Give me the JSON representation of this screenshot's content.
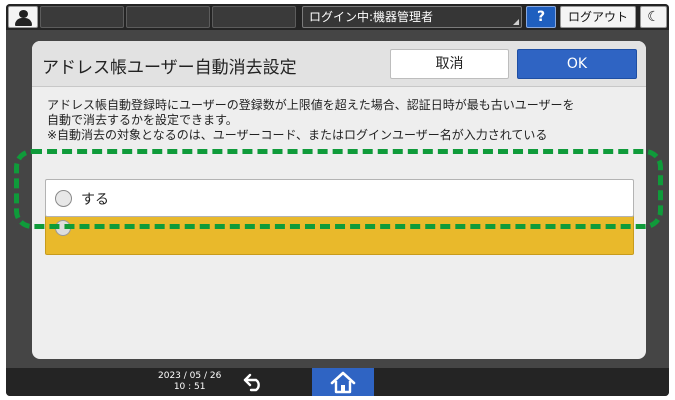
{
  "topbar": {
    "login_status": "ログイン中:機器管理者",
    "help_label": "?",
    "logout_label": "ログアウト",
    "night_mode_glyph": "☾"
  },
  "dialog": {
    "title": "アドレス帳ユーザー自動消去設定",
    "cancel_label": "取消",
    "ok_label": "OK",
    "description": [
      "アドレス帳自動登録時にユーザーの登録数が上限値を超えた場合、認証日時が最も古いユーザーを",
      "自動で消去するかを設定できます。",
      "※自動消去の対象となるのは、ユーザーコード、またはログインユーザー名が入力されている"
    ],
    "options": [
      {
        "label": "する",
        "selected": false
      },
      {
        "label": "",
        "selected": true
      }
    ]
  },
  "bottombar": {
    "date": "2023 / 05 / 26",
    "time": "10 : 51"
  },
  "colors": {
    "accent_blue": "#2f64c3",
    "selected_option": "#e9b92b",
    "highlight_green": "#0f9b3a"
  }
}
